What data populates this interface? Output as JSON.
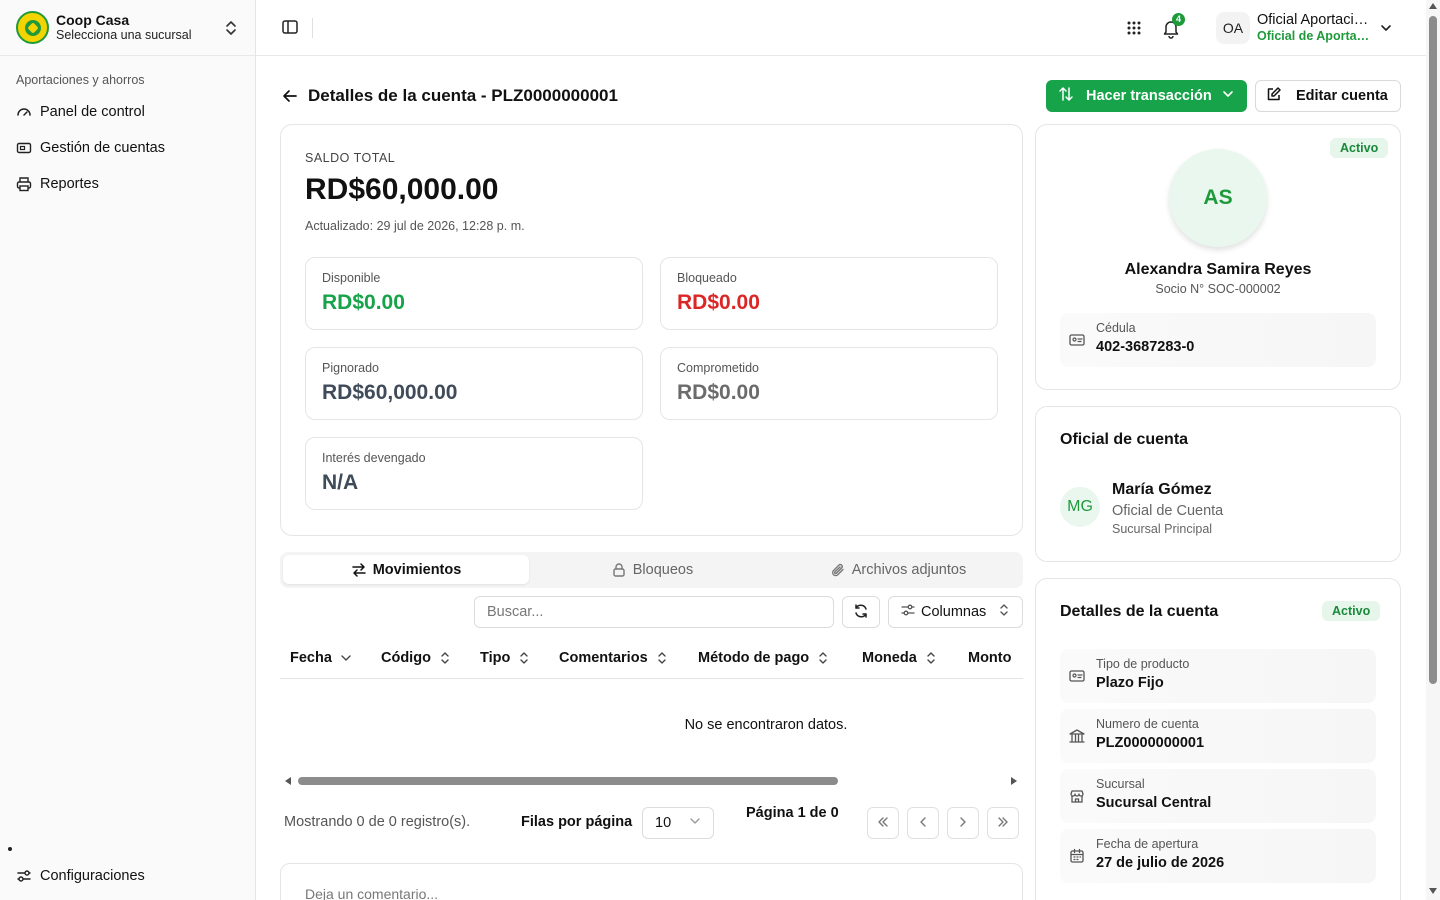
{
  "sidebar": {
    "org_name": "Coop Casa",
    "org_sub": "Selecciona una sucursal",
    "group_label": "Aportaciones y ahorros",
    "items": [
      {
        "label": "Panel de control"
      },
      {
        "label": "Gestión de cuentas"
      },
      {
        "label": "Reportes"
      }
    ],
    "bottom_item": "Configuraciones"
  },
  "topbar": {
    "notification_count": "4",
    "user_initials": "OA",
    "user_name": "Oficial Aportaciones",
    "user_role": "Oficial de Aportaciones"
  },
  "page": {
    "title": "Detalles de la cuenta - PLZ0000000001",
    "btn_transaction": "Hacer transacción",
    "btn_edit": "Editar cuenta"
  },
  "balance": {
    "label": "SALDO TOTAL",
    "total": "RD$60,000.00",
    "updated": "Actualizado: 29 jul de 2026, 12:28 p. m.",
    "items": [
      {
        "label": "Disponible",
        "value": "RD$0.00"
      },
      {
        "label": "Bloqueado",
        "value": "RD$0.00"
      },
      {
        "label": "Pignorado",
        "value": "RD$60,000.00"
      },
      {
        "label": "Comprometido",
        "value": "RD$0.00"
      },
      {
        "label": "Interés devengado",
        "value": "N/A"
      }
    ]
  },
  "tabs": [
    {
      "label": "Movimientos"
    },
    {
      "label": "Bloqueos"
    },
    {
      "label": "Archivos adjuntos"
    }
  ],
  "toolbar": {
    "search_placeholder": "Buscar...",
    "columns_label": "Columnas"
  },
  "table": {
    "headers": [
      "Fecha",
      "Código",
      "Tipo",
      "Comentarios",
      "Método de pago",
      "Moneda",
      "Monto"
    ],
    "empty_text": "No se encontraron datos."
  },
  "pagination": {
    "showing": "Mostrando 0 de 0 registro(s).",
    "rows_label": "Filas por página",
    "rows_value": "10",
    "page_info": "Página 1 de 0"
  },
  "comment": {
    "placeholder": "Deja un comentario..."
  },
  "profile": {
    "status": "Activo",
    "initials": "AS",
    "name": "Alexandra Samira Reyes",
    "socio": "Socio N° SOC-000002",
    "cedula_label": "Cédula",
    "cedula_value": "402-3687283-0"
  },
  "officer": {
    "title": "Oficial de cuenta",
    "initials": "MG",
    "name": "María Gómez",
    "role": "Oficial de Cuenta",
    "branch": "Sucursal Principal"
  },
  "details": {
    "title": "Detalles de la cuenta",
    "status": "Activo",
    "rows": [
      {
        "label": "Tipo de producto",
        "value": "Plazo Fijo"
      },
      {
        "label": "Numero de cuenta",
        "value": "PLZ0000000001"
      },
      {
        "label": "Sucursal",
        "value": "Sucursal Central"
      },
      {
        "label": "Fecha de apertura",
        "value": "27 de julio de 2026"
      }
    ]
  },
  "colors": {
    "accent": "#17a34a",
    "available": "#16a34a",
    "blocked": "#dc2626",
    "pledged": "#404b5a",
    "committed": "#6b6b6b"
  }
}
